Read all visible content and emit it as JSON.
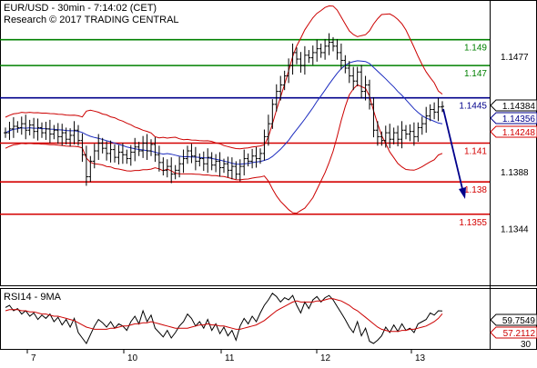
{
  "header": {
    "symbol_line": "EUR/USD - 30min - 7:14:02 (CET)",
    "research_line": "Research © 2017 TRADING CENTRAL"
  },
  "colors": {
    "resistance": "#008000",
    "pivot": "#00008b",
    "support": "#d40000",
    "price_bars": "#000000",
    "bollinger": "#cc0000",
    "moving_average": "#1b2bbf",
    "rsi_line": "#000000",
    "rsi_ma": "#cc0000",
    "arrow": "#00008b"
  },
  "chart_data": [
    {
      "type": "candlestick",
      "title": "EUR/USD - 30min",
      "indicators": [
        "Bollinger Bands",
        "Moving Average"
      ],
      "x_ticks": [
        "7",
        "10",
        "11",
        "12",
        "13"
      ],
      "y_axis": {
        "range": [
          1.13,
          1.152
        ],
        "ticks": [
          1.1477,
          1.1388,
          1.1344
        ]
      },
      "grid": false,
      "levels": [
        {
          "value": 1.149,
          "label": "1.149",
          "role": "resistance"
        },
        {
          "value": 1.147,
          "label": "1.147",
          "role": "resistance"
        },
        {
          "value": 1.1445,
          "label": "1.1445",
          "role": "pivot"
        },
        {
          "value": 1.141,
          "label": "1.141",
          "role": "support"
        },
        {
          "value": 1.138,
          "label": "1.138",
          "role": "support"
        },
        {
          "value": 1.1355,
          "label": "1.1355",
          "role": "support"
        }
      ],
      "price_tags": [
        {
          "value": 1.14384,
          "label": "1.14384",
          "style": "last"
        },
        {
          "value": 1.14356,
          "label": "1.14356",
          "style": "ma"
        },
        {
          "value": 1.14248,
          "label": "1.14248",
          "style": "band"
        }
      ],
      "close_series": [
        1.1418,
        1.1421,
        1.1423,
        1.1422,
        1.1425,
        1.142,
        1.1424,
        1.1419,
        1.1422,
        1.1418,
        1.1421,
        1.1417,
        1.142,
        1.1415,
        1.1418,
        1.1413,
        1.1416,
        1.142,
        1.1412,
        1.1401,
        1.1384,
        1.1396,
        1.1404,
        1.141,
        1.1406,
        1.1402,
        1.1405,
        1.1399,
        1.1403,
        1.1401,
        1.1398,
        1.1403,
        1.1407,
        1.1404,
        1.141,
        1.1404,
        1.1409,
        1.1401,
        1.1395,
        1.1389,
        1.1392,
        1.1386,
        1.1389,
        1.1394,
        1.1398,
        1.1404,
        1.14,
        1.1396,
        1.1398,
        1.1394,
        1.1399,
        1.1393,
        1.1396,
        1.1391,
        1.1394,
        1.1389,
        1.1392,
        1.1386,
        1.1392,
        1.1398,
        1.1396,
        1.14,
        1.1398,
        1.1402,
        1.1415,
        1.1425,
        1.144,
        1.145,
        1.1455,
        1.1462,
        1.147,
        1.148,
        1.1475,
        1.147,
        1.1478,
        1.1476,
        1.148,
        1.1483,
        1.148,
        1.1485,
        1.1488,
        1.1485,
        1.148,
        1.1474,
        1.1468,
        1.1462,
        1.1458,
        1.1465,
        1.145,
        1.1455,
        1.144,
        1.142,
        1.1415,
        1.1412,
        1.1418,
        1.1413,
        1.1418,
        1.1413,
        1.142,
        1.1417,
        1.1419,
        1.1415,
        1.1422,
        1.1425,
        1.1431,
        1.1436,
        1.1434,
        1.1438,
        1.14384
      ]
    },
    {
      "type": "line",
      "title": "RSI14 - 9MA",
      "x_ticks": [
        "7",
        "10",
        "11",
        "12",
        "13"
      ],
      "y_axis": {
        "range": [
          25,
          80
        ],
        "ticks": [
          30
        ]
      },
      "price_tags": [
        {
          "value": 59.7549,
          "label": "59.7549",
          "style": "rsi"
        },
        {
          "value": 57.2112,
          "label": "57.2112",
          "style": "ma"
        }
      ],
      "series": [
        {
          "role": "rsi",
          "values": [
            63,
            65,
            60,
            62,
            57,
            60,
            55,
            58,
            52,
            56,
            53,
            57,
            50,
            54,
            47,
            52,
            45,
            53,
            40,
            35,
            30,
            38,
            46,
            52,
            49,
            45,
            50,
            44,
            48,
            46,
            42,
            50,
            55,
            48,
            60,
            50,
            56,
            44,
            40,
            36,
            42,
            35,
            40,
            46,
            50,
            57,
            53,
            46,
            50,
            44,
            52,
            42,
            48,
            39,
            45,
            37,
            42,
            33,
            46,
            53,
            48,
            55,
            50,
            58,
            65,
            70,
            76,
            73,
            68,
            72,
            70,
            74,
            65,
            58,
            68,
            62,
            70,
            73,
            68,
            72,
            74,
            70,
            64,
            58,
            52,
            45,
            40,
            50,
            37,
            44,
            32,
            30,
            33,
            37,
            45,
            40,
            47,
            41,
            48,
            42,
            44,
            40,
            48,
            50,
            52,
            58,
            56,
            60,
            59.75
          ]
        },
        {
          "role": "ma",
          "values": [
            60,
            61,
            61,
            61,
            60,
            60,
            59,
            59,
            58,
            57,
            57,
            56,
            55,
            55,
            54,
            53,
            52,
            51,
            49,
            47,
            45,
            44,
            43,
            43,
            43,
            43,
            44,
            44,
            45,
            46,
            46,
            47,
            48,
            48,
            49,
            49,
            50,
            49,
            48,
            47,
            46,
            45,
            44,
            44,
            44,
            44,
            45,
            46,
            47,
            47,
            48,
            47,
            47,
            46,
            46,
            45,
            44,
            43,
            43,
            44,
            45,
            46,
            47,
            49,
            51,
            54,
            57,
            60,
            62,
            64,
            66,
            68,
            69,
            68,
            68,
            68,
            68,
            69,
            69,
            70,
            71,
            71,
            70,
            69,
            67,
            65,
            62,
            60,
            57,
            54,
            51,
            48,
            45,
            43,
            42,
            41,
            41,
            41,
            42,
            42,
            43,
            43,
            44,
            45,
            46,
            48,
            50,
            53,
            57.21
          ]
        }
      ]
    }
  ]
}
